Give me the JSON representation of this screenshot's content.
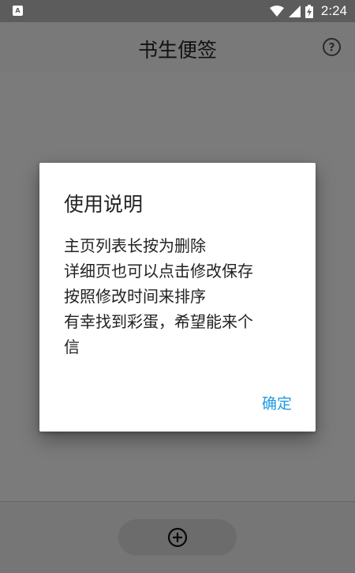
{
  "status_bar": {
    "time": "2:24",
    "left_icon_letter": "A",
    "icons": [
      "wifi-icon",
      "signal-icon",
      "battery-charging-icon"
    ]
  },
  "app_bar": {
    "title": "书生便签",
    "help_icon": "help-icon",
    "help_glyph": "?"
  },
  "bottom_bar": {
    "add_icon": "add-circle-icon"
  },
  "dialog": {
    "title": "使用说明",
    "lines": [
      "主页列表长按为删除",
      "详细页也可以点击修改保存",
      "按照修改时间来排序",
      "有幸找到彩蛋，希望能来个",
      "信"
    ],
    "ok_label": "确定"
  },
  "colors": {
    "accent": "#1e9be6",
    "status_bar": "#5c5c5c",
    "scrim": "rgba(0,0,0,0.5)"
  }
}
